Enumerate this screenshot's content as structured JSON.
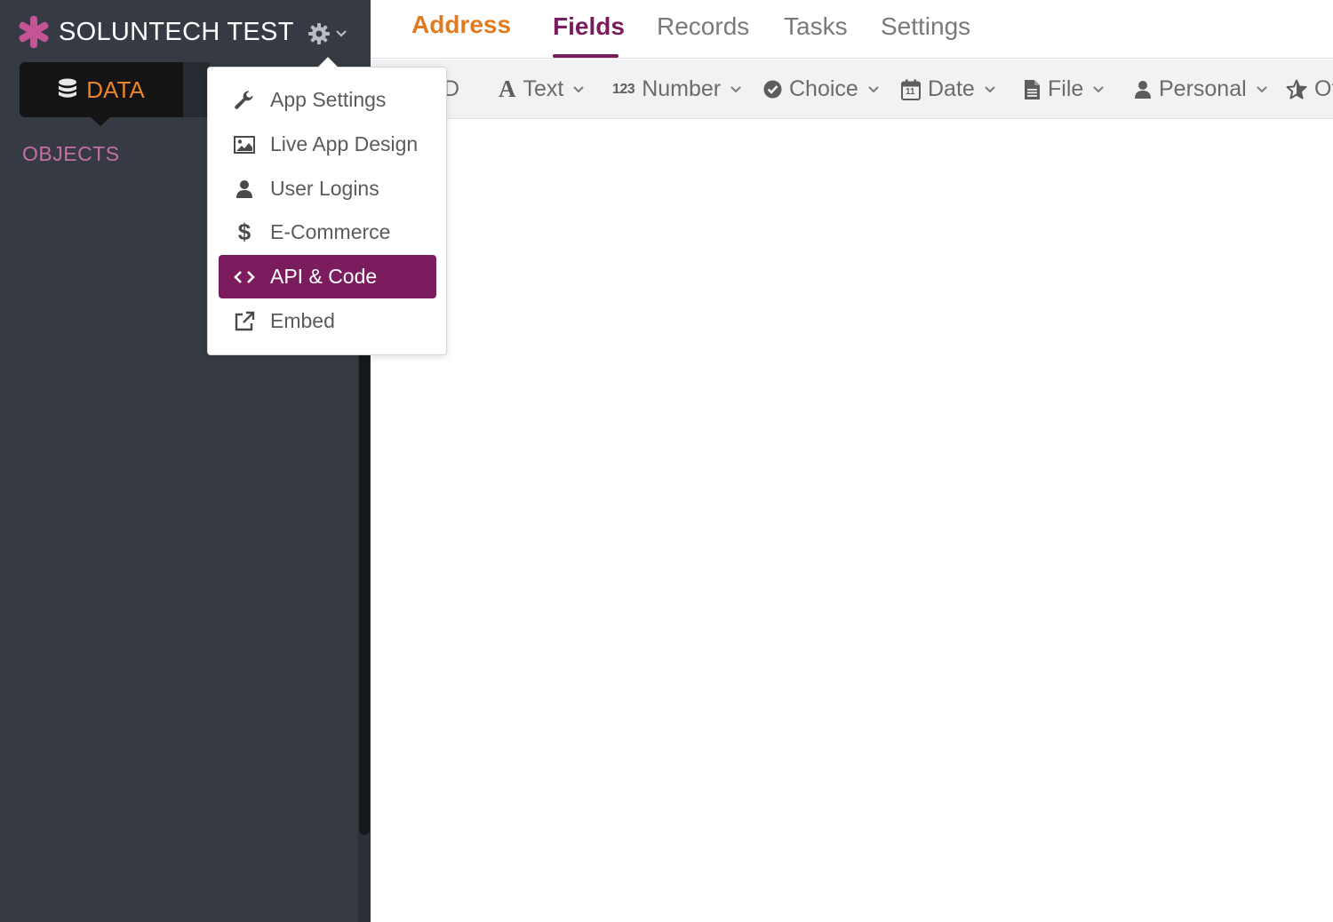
{
  "app": {
    "title": "SOLUNTECH TEST",
    "brand_color": "#c35496",
    "settings_icon": "gear-icon"
  },
  "sidebar": {
    "mode_tab_label": "DATA",
    "mode_tab_icon": "database-icon",
    "objects_heading": "OBJECTS"
  },
  "top_tabs": {
    "object_name": "Address",
    "fields": "Fields",
    "records": "Records",
    "tasks": "Tasks",
    "settings": "Settings",
    "active": "Fields"
  },
  "field_types": {
    "id": "D",
    "text": "Text",
    "number": "Number",
    "number_icon_text": "123",
    "choice": "Choice",
    "date": "Date",
    "date_icon_text": "11",
    "file": "File",
    "personal": "Personal",
    "other": "Ot"
  },
  "settings_menu": {
    "items": [
      {
        "label": "App Settings",
        "icon": "wrench-icon"
      },
      {
        "label": "Live App Design",
        "icon": "image-icon"
      },
      {
        "label": "User Logins",
        "icon": "user-icon"
      },
      {
        "label": "E-Commerce",
        "icon": "dollar-icon"
      },
      {
        "label": "API & Code",
        "icon": "code-icon"
      },
      {
        "label": "Embed",
        "icon": "external-link-icon"
      }
    ],
    "active_item": "API & Code",
    "active_color": "#7b1c5e"
  },
  "colors": {
    "sidebar_bg": "#353a43",
    "accent_orange": "#e07b22",
    "accent_purple": "#7b1c5e",
    "objects_pink": "#c66fa6"
  }
}
